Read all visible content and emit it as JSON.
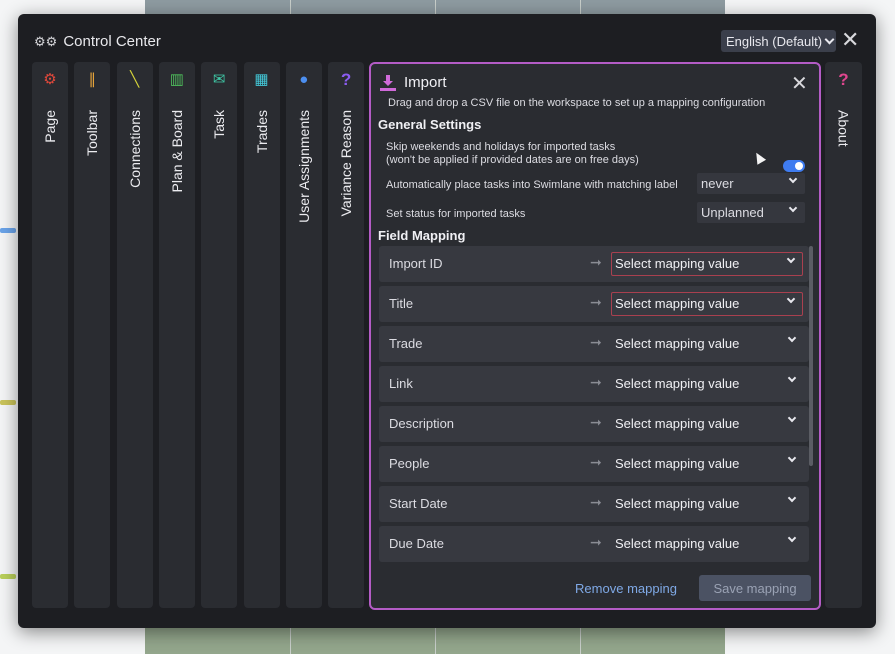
{
  "dialog": {
    "title": "Control Center",
    "language": "English (Default)"
  },
  "tabs": [
    {
      "label": "Page",
      "icon": "cogs-icon",
      "color": "#e0483b"
    },
    {
      "label": "Toolbar",
      "icon": "tools-icon",
      "color": "#e3a23a"
    },
    {
      "label": "Connections",
      "icon": "connections-icon",
      "color": "#d4d23a"
    },
    {
      "label": "Plan & Board",
      "icon": "board-icon",
      "color": "#4fbf5c"
    },
    {
      "label": "Task",
      "icon": "task-icon",
      "color": "#3fc8a6"
    },
    {
      "label": "Trades",
      "icon": "building-icon",
      "color": "#43c8d8"
    },
    {
      "label": "User Assignments",
      "icon": "user-icon",
      "color": "#4c8ff0"
    },
    {
      "label": "Variance Reason",
      "icon": "question-icon",
      "color": "#8b5cf0"
    }
  ],
  "about_tab": {
    "label": "About",
    "icon": "question-icon",
    "color": "#e0468f"
  },
  "import_panel": {
    "title": "Import",
    "subtitle": "Drag and drop a CSV file on the workspace to set up a mapping configuration",
    "general_settings_title": "General Settings",
    "skip_weekends_label_line1": "Skip weekends and holidays for imported tasks",
    "skip_weekends_label_line2": "(won't be applied if provided dates are on free days)",
    "skip_weekends_enabled": true,
    "swimlane_label": "Automatically place tasks into Swimlane with matching label",
    "swimlane_value": "never",
    "status_label": "Set status for imported tasks",
    "status_value": "Unplanned",
    "field_mapping_title": "Field Mapping",
    "mappings": [
      {
        "field": "Import ID",
        "value": "Select mapping value",
        "required": true
      },
      {
        "field": "Title",
        "value": "Select mapping value",
        "required": true
      },
      {
        "field": "Trade",
        "value": "Select mapping value",
        "required": false
      },
      {
        "field": "Link",
        "value": "Select mapping value",
        "required": false
      },
      {
        "field": "Description",
        "value": "Select mapping value",
        "required": false
      },
      {
        "field": "People",
        "value": "Select mapping value",
        "required": false
      },
      {
        "field": "Start Date",
        "value": "Select mapping value",
        "required": false
      },
      {
        "field": "Due Date",
        "value": "Select mapping value",
        "required": false
      }
    ],
    "remove_label": "Remove mapping",
    "save_label": "Save mapping"
  }
}
